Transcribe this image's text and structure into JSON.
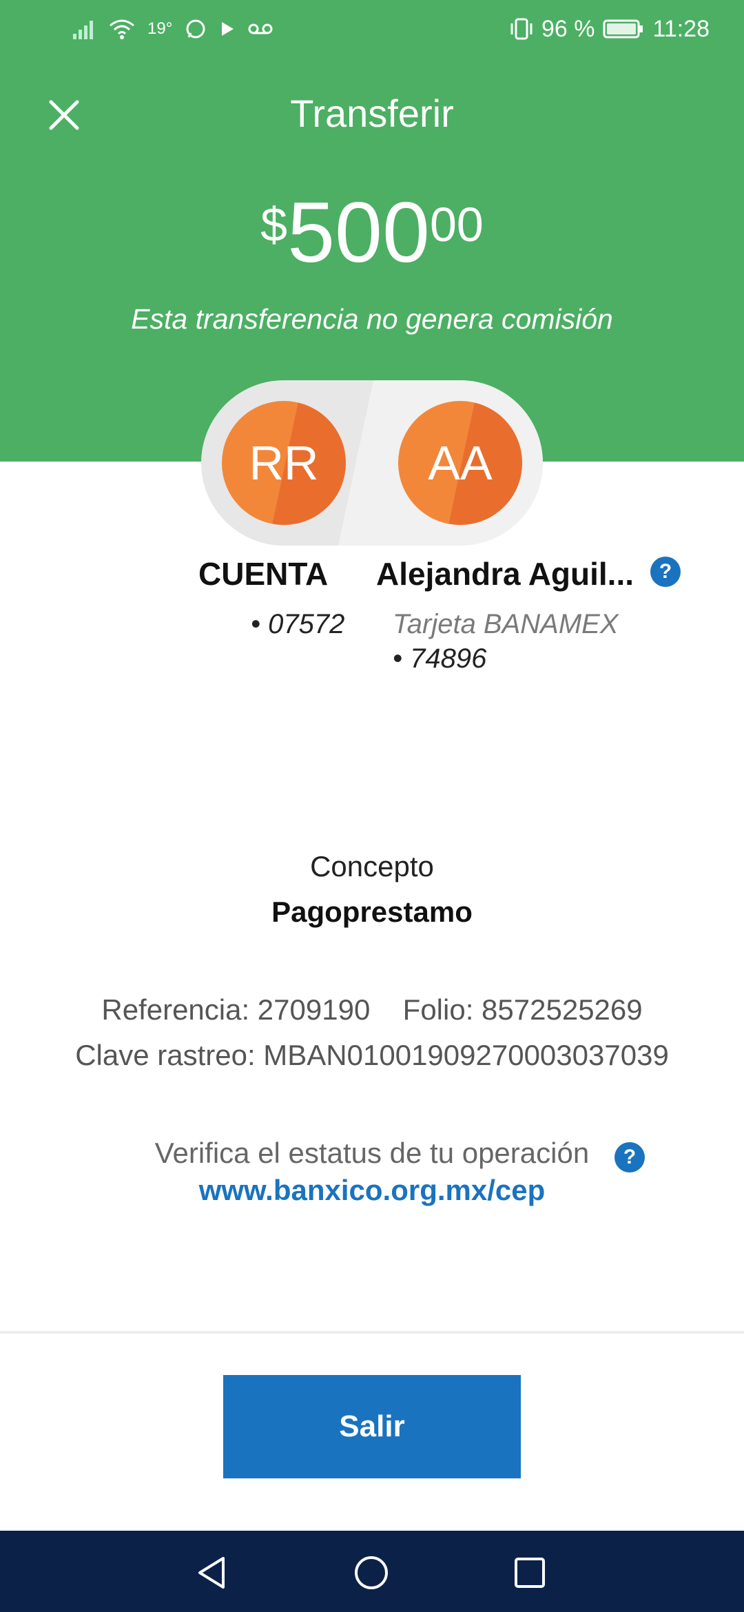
{
  "status_bar": {
    "temperature": "19°",
    "battery": "96 %",
    "time": "11:28"
  },
  "header": {
    "title": "Transferir",
    "amount_currency": "$",
    "amount_integer": "500",
    "amount_decimals": "00",
    "subtitle": "Esta transferencia no genera comisión",
    "bg_color": "#4caf64"
  },
  "from_account": {
    "initials": "RR",
    "name": "CUENTA",
    "number": "• 07572"
  },
  "to_account": {
    "initials": "AA",
    "name": "Alejandra Aguil...",
    "bank": "Tarjeta BANAMEX",
    "number": "• 74896",
    "help_label": "?"
  },
  "concept": {
    "label": "Concepto",
    "value": "Pagoprestamo"
  },
  "details": {
    "reference": "Referencia: 2709190",
    "folio": "Folio: 8572525269",
    "clave": "Clave rastreo: MBAN01001909270003037039"
  },
  "verify": {
    "text": "Verifica el estatus de tu operación",
    "link": "www.banxico.org.mx/cep",
    "help_label": "?"
  },
  "actions": {
    "exit_label": "Salir",
    "accent": "#1a73bf"
  },
  "icons": {
    "close": "close-icon",
    "back": "back-icon",
    "home": "home-icon",
    "recents": "recents-icon"
  }
}
